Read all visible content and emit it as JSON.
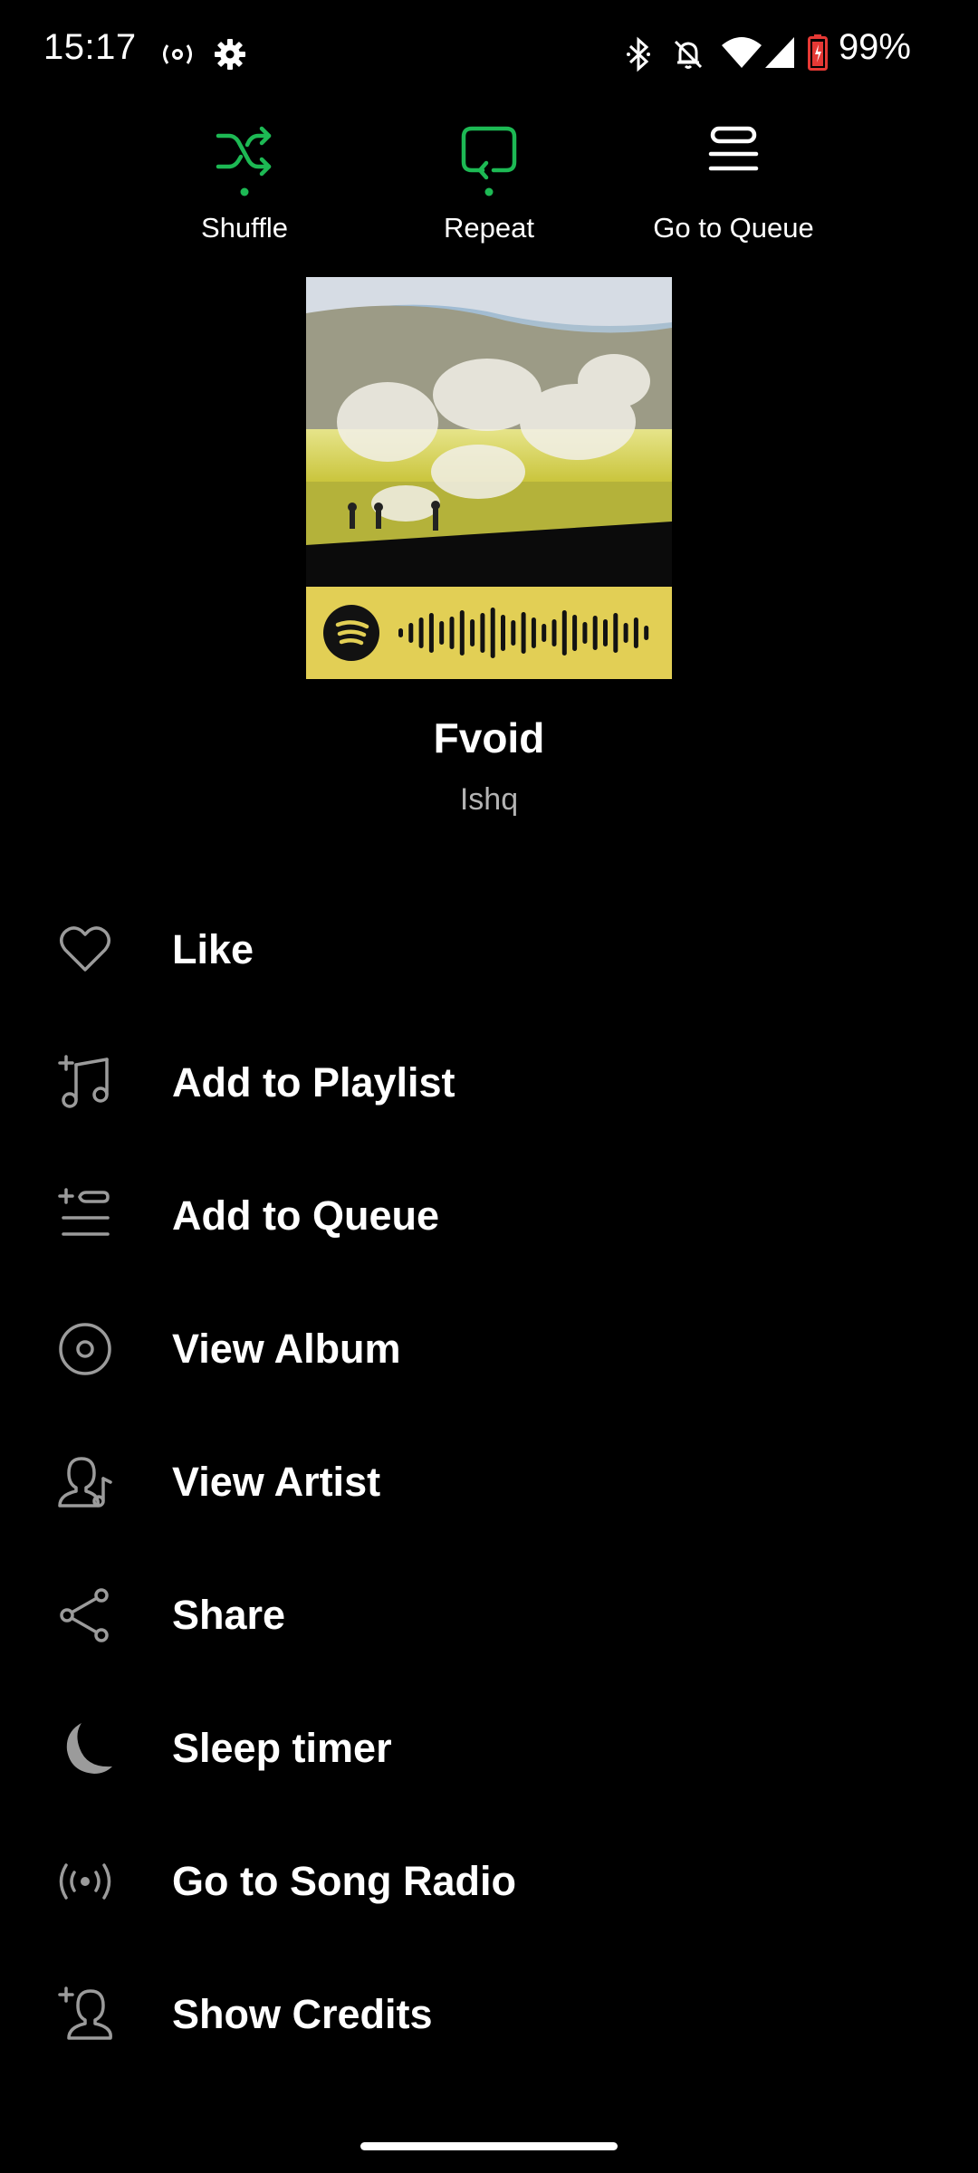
{
  "status_bar": {
    "time": "15:17",
    "battery": "99%",
    "icons": [
      "radio-signal-icon",
      "settings-gear-icon",
      "bluetooth-icon",
      "notifications-off-icon",
      "wifi-icon",
      "cellular-signal-icon",
      "battery-icon"
    ]
  },
  "controls": {
    "shuffle": "Shuffle",
    "repeat": "Repeat",
    "queue": "Go to Queue",
    "accent_color": "#1db954"
  },
  "track": {
    "title": "Fvoid",
    "artist": "Ishq"
  },
  "menu": {
    "items": [
      {
        "label": "Like",
        "icon": "heart-icon"
      },
      {
        "label": "Add to Playlist",
        "icon": "add-to-playlist-icon"
      },
      {
        "label": "Add to Queue",
        "icon": "add-to-queue-icon"
      },
      {
        "label": "View Album",
        "icon": "album-icon"
      },
      {
        "label": "View Artist",
        "icon": "artist-icon"
      },
      {
        "label": "Share",
        "icon": "share-icon"
      },
      {
        "label": "Sleep timer",
        "icon": "moon-icon"
      },
      {
        "label": "Go to Song Radio",
        "icon": "radio-icon"
      },
      {
        "label": "Show Credits",
        "icon": "credits-icon"
      }
    ]
  },
  "colors": {
    "background": "#000000",
    "secondary_text": "#b3b3b3",
    "code_bar_yellow": "#e2cf55"
  }
}
